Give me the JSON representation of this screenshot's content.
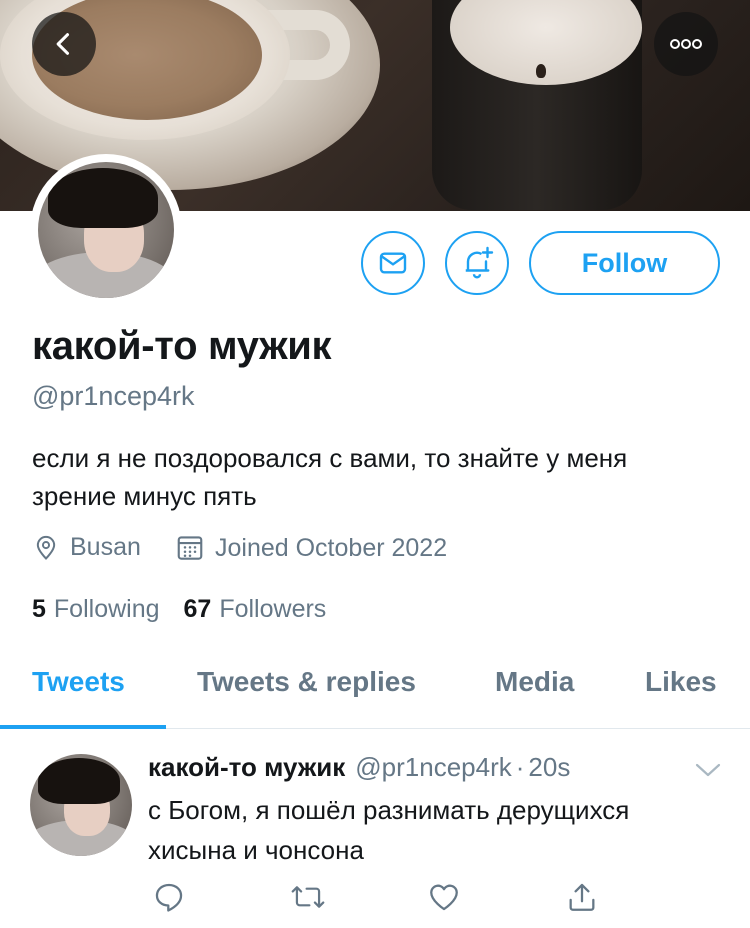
{
  "profile": {
    "name": "какой-то мужик",
    "handle": "@pr1ncep4rk",
    "bio": "если я не поздоровался с вами, то знайте у меня зрение минус пять",
    "location": "Busan",
    "joined": "Joined October 2022",
    "following_count": "5",
    "following_label": "Following",
    "followers_count": "67",
    "followers_label": "Followers"
  },
  "actions": {
    "follow_label": "Follow"
  },
  "tabs": [
    {
      "label": "Tweets",
      "active": true
    },
    {
      "label": "Tweets & replies",
      "active": false
    },
    {
      "label": "Media",
      "active": false
    },
    {
      "label": "Likes",
      "active": false
    }
  ],
  "tweet": {
    "name": "какой-то мужик",
    "handle": "@pr1ncep4rk",
    "separator": "·",
    "time": "20s",
    "text": "с Богом, я пошёл разнимать дерущихся хисына и чонсона"
  },
  "icons": {
    "back": "chevron-left-icon",
    "more": "more-horizontal-icon",
    "message": "envelope-icon",
    "notify": "bell-plus-icon",
    "location": "location-pin-icon",
    "calendar": "calendar-icon",
    "reply": "reply-icon",
    "retweet": "retweet-icon",
    "like": "heart-icon",
    "share": "share-icon",
    "caret": "chevron-down-icon"
  },
  "colors": {
    "accent": "#1da1f2",
    "secondary_text": "#657786",
    "primary_text": "#14171a"
  }
}
